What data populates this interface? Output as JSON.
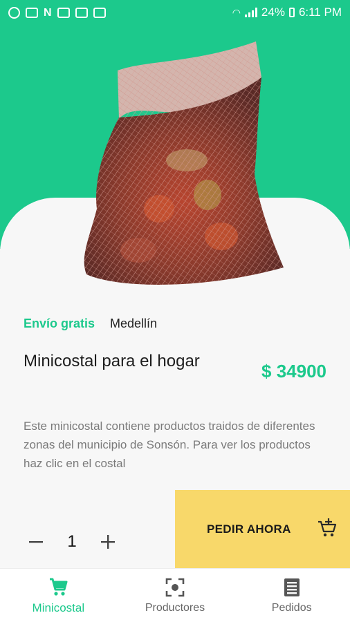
{
  "status_bar": {
    "battery": "24%",
    "time": "6:11 PM",
    "left_icons": [
      "whatsapp-icon",
      "gallery-icon",
      "netflix-icon",
      "mail-icon",
      "laptop-icon",
      "mail-icon"
    ]
  },
  "product": {
    "shipping_label": "Envío gratis",
    "city": "Medellín",
    "title": "Minicostal para el hogar",
    "price": "$ 34900",
    "description": "Este minicostal contiene productos traidos de diferentes zonas del municipio de Sonsón. Para ver los productos haz clic en el costal",
    "quantity": "1"
  },
  "actions": {
    "order_label": "PEDIR AHORA"
  },
  "bottom_nav": [
    {
      "label": "Minicostal",
      "icon": "cart-icon",
      "active": true
    },
    {
      "label": "Productores",
      "icon": "scan-icon",
      "active": false
    },
    {
      "label": "Pedidos",
      "icon": "list-icon",
      "active": false
    }
  ],
  "colors": {
    "accent": "#1cc98c",
    "order_button": "#f8d86a"
  }
}
